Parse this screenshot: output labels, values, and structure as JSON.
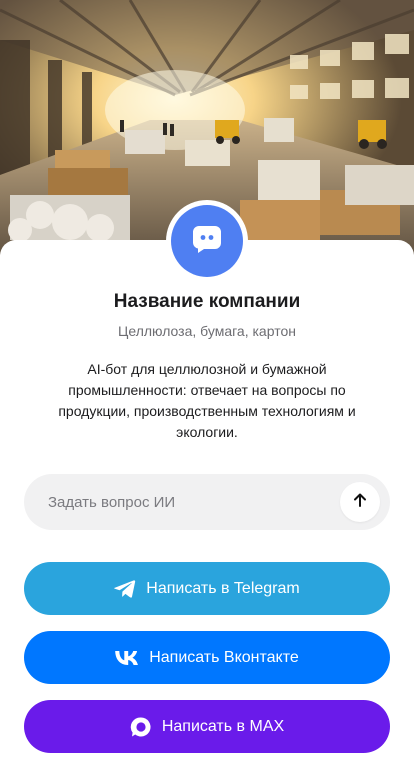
{
  "hero": {
    "image": "warehouse-illustration",
    "colors": {
      "sky": "#f6d48a",
      "floor": "#8a7863",
      "light": "#fff3c8"
    }
  },
  "company": {
    "avatar_icon": "chat-bot-icon",
    "avatar_color": "#4f7ff2",
    "name": "Название компании",
    "tagline": "Целлюлоза, бумага, картон",
    "description": "AI-бот для целлюлозной и бумажной промышленности: отвечает на вопросы по продукции, производственным технологиям и экологии."
  },
  "ask": {
    "placeholder": "Задать вопрос ИИ",
    "value": "",
    "send_icon": "arrow-up-icon"
  },
  "buttons": {
    "telegram": {
      "label": "Написать в Telegram",
      "icon": "telegram-icon",
      "color": "#2aa4dd"
    },
    "vk": {
      "label": "Написать Вконтакте",
      "icon": "vk-icon",
      "color": "#0077ff"
    },
    "max": {
      "label": "Написать в MAX",
      "icon": "max-icon",
      "color": "#6a1bea"
    }
  }
}
